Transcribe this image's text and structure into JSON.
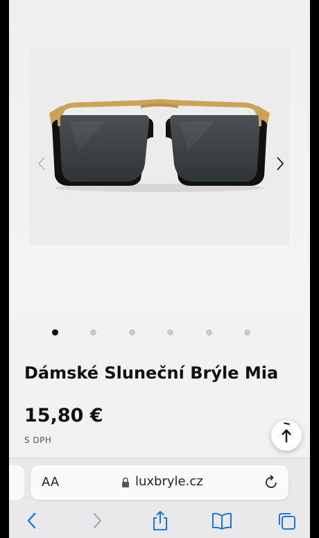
{
  "product": {
    "title": "Dámské Sluneční Brýle Mia",
    "price": "15,80 €",
    "tax_note": "S DPH"
  },
  "gallery": {
    "image_count": 6,
    "active_index": 0,
    "prev_icon": "chevron-left-icon",
    "next_icon": "chevron-right-icon"
  },
  "browser": {
    "text_size_label": "AA",
    "url": "luxbryle.cz"
  },
  "colors": {
    "accent": "#1a73e8",
    "text": "#111111",
    "frame": "#111111",
    "gold": "#c9a458",
    "lens": "#3e4448"
  }
}
